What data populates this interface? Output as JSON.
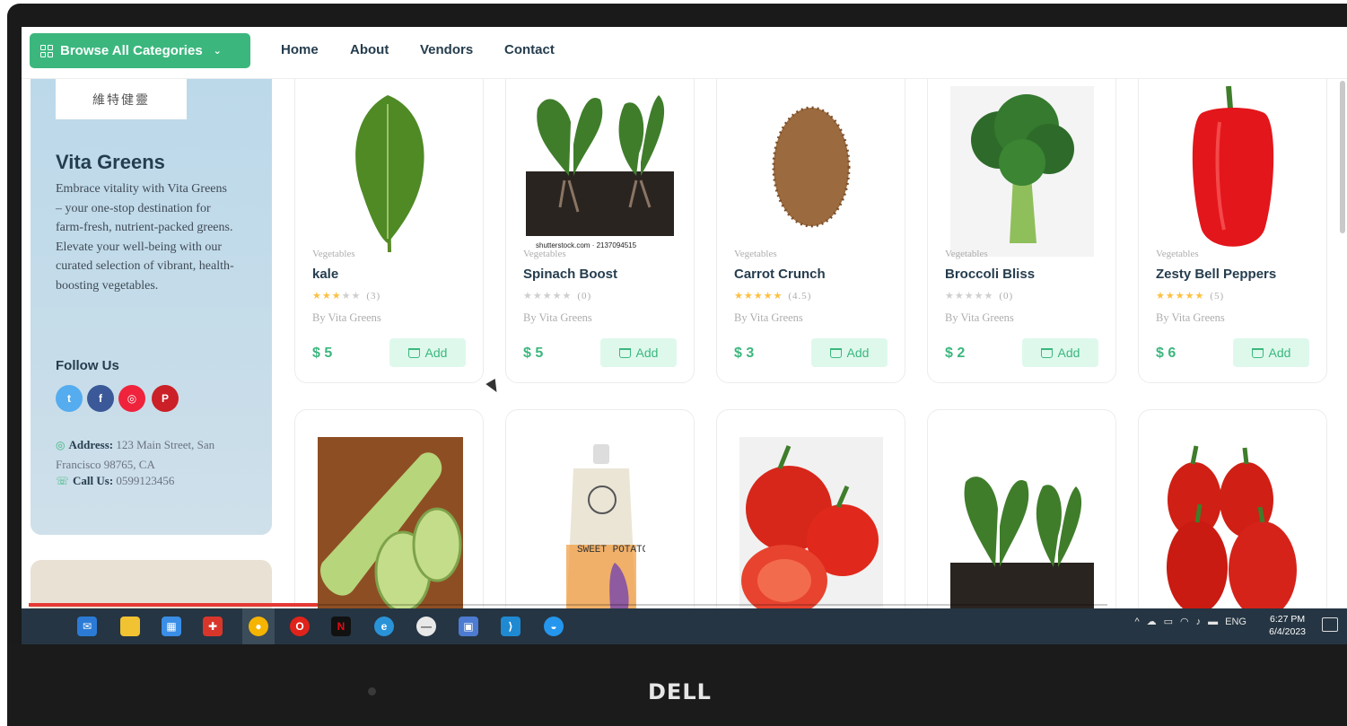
{
  "nav": {
    "browse_label": "Browse All Categories",
    "links": [
      "Home",
      "About",
      "Vendors",
      "Contact"
    ]
  },
  "vendor": {
    "logo_text": "維特健靈",
    "name": "Vita Greens",
    "description": "Embrace vitality with Vita Greens – your one-stop destination for farm-fresh, nutrient-packed greens. Elevate your well-being with our curated selection of vibrant, health-boosting vegetables.",
    "follow_label": "Follow Us",
    "social_icons": [
      "twitter-icon",
      "facebook-icon",
      "instagram-icon",
      "pinterest-icon"
    ],
    "address_label": "Address:",
    "address": "123 Main Street, San Francisco 98765, CA",
    "call_label": "Call Us:",
    "phone": "0599123456"
  },
  "products": [
    {
      "category": "Vegetables",
      "name": "kale",
      "rating_stars": 3,
      "rating_text": "(3)",
      "by": "By Vita Greens",
      "price": "$ 5",
      "add_label": "Add"
    },
    {
      "category": "Vegetables",
      "name": "Spinach Boost",
      "rating_stars": 0,
      "rating_text": "(0)",
      "by": "By Vita Greens",
      "price": "$ 5",
      "add_label": "Add",
      "image_caption": "shutterstock.com · 2137094515"
    },
    {
      "category": "Vegetables",
      "name": "Carrot Crunch",
      "rating_stars": 5,
      "rating_text": "(4.5)",
      "by": "By Vita Greens",
      "price": "$ 3",
      "add_label": "Add"
    },
    {
      "category": "Vegetables",
      "name": "Broccoli Bliss",
      "rating_stars": 0,
      "rating_text": "(0)",
      "by": "By Vita Greens",
      "price": "$ 2",
      "add_label": "Add"
    },
    {
      "category": "Vegetables",
      "name": "Zesty Bell Peppers",
      "rating_stars": 5,
      "rating_text": "(5)",
      "by": "By Vita Greens",
      "price": "$ 6",
      "add_label": "Add"
    }
  ],
  "second_row_images": [
    "cucumber",
    "sweet potato parsnip pouch",
    "tomatoes",
    "spinach",
    "tomatoes"
  ],
  "pouch_text": "SWEET POTATO & PARSNIP",
  "taskbar": {
    "tray_lang": "ENG",
    "time": "6:27 PM",
    "date": "6/4/2023"
  },
  "monitor_brand": "DELL",
  "colors": {
    "accent": "#3bb77e",
    "add_bg": "#def9ec",
    "star": "#fdc040",
    "heading": "#253d4e"
  }
}
